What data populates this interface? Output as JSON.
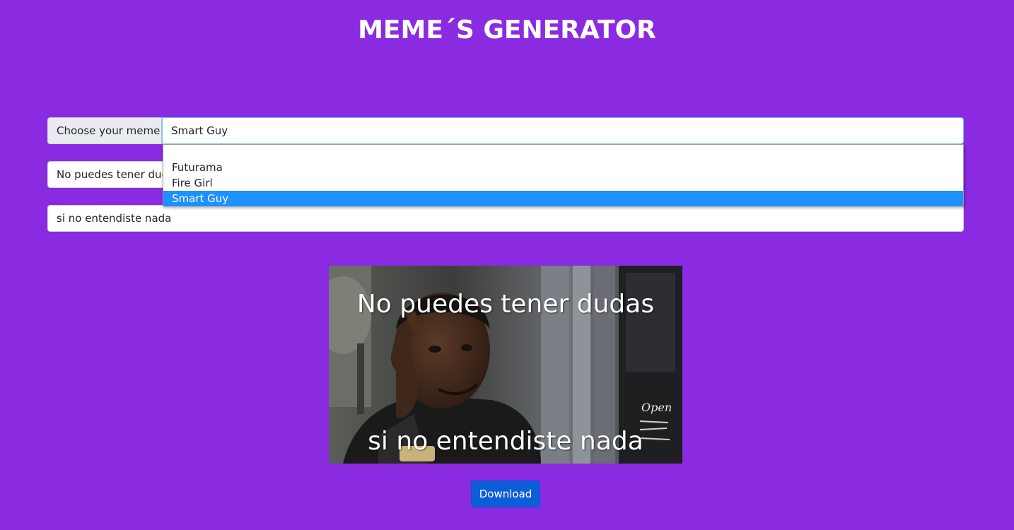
{
  "page": {
    "title": "MEME´S GENERATOR"
  },
  "chooser": {
    "label": "Choose your meme",
    "selected": "Smart Guy",
    "options": [
      "",
      "Futurama",
      "Fire Girl",
      "Smart Guy"
    ]
  },
  "inputs": {
    "top_text": "No puedes tener dudas",
    "bottom_text": "si no entendiste nada"
  },
  "meme": {
    "top_caption": "No puedes tener dudas",
    "bottom_caption": "si no entendiste nada",
    "sign_text": "Open"
  },
  "actions": {
    "download_label": "Download"
  },
  "colors": {
    "background": "#8a2be2",
    "button": "#0b5ed7",
    "selected_option": "#1e90ff"
  }
}
